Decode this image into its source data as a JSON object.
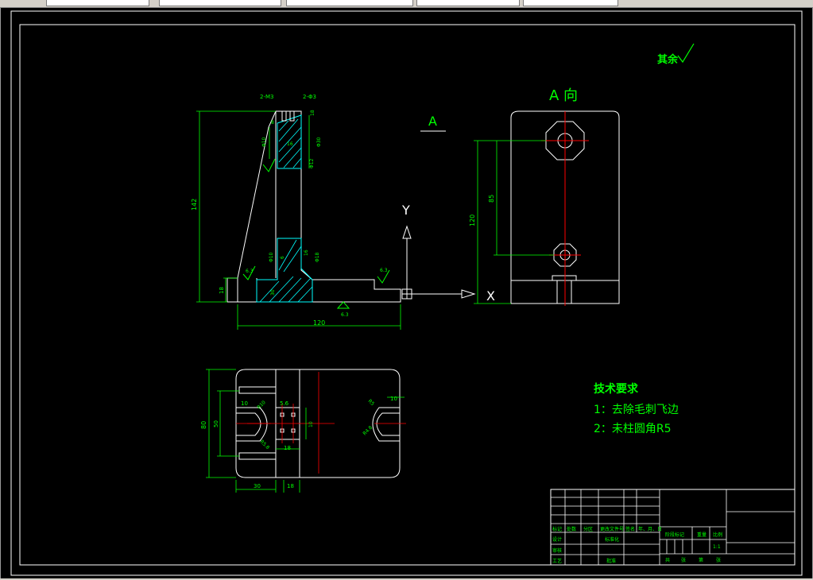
{
  "colors": {
    "background": "#000000",
    "outline": "#ffffff",
    "dimension": "#00ff00",
    "centerline": "#ff0000",
    "hatch": "#00ffff",
    "annotation": "#00ff00"
  },
  "tabs": [
    "",
    "",
    "",
    "",
    ""
  ],
  "roughness_note": "其余",
  "view_a_label": "A 向",
  "section_arrow_label": "A",
  "axis_y": "Y",
  "axis_x": "X",
  "front_view": {
    "dims": {
      "height_142": "142",
      "width_120": "120",
      "base_18": "18",
      "tap_left": "2-M3",
      "tap_right": "2-Φ3",
      "dia_10": "Φ10",
      "dia_30": "Φ30",
      "dim_16": "16",
      "dim_18_top": "18",
      "dim_8": "8",
      "dim_12": "Φ12",
      "dim_16_mid": "16",
      "dim_18_mid": "Φ18",
      "dim_6_mid": "6",
      "dim_10_mid": "Φ10",
      "dim_30_low": "30",
      "rough_1": "6.3",
      "rough_2": "6.3",
      "rough_3": "6.3"
    }
  },
  "side_view": {
    "dims": {
      "height_120": "120",
      "dim_85": "85"
    }
  },
  "top_view": {
    "dims": {
      "height_80": "80",
      "dim_50": "50",
      "dim_10_left": "10",
      "dim_10_right": "10",
      "dim_5_6": "5.6",
      "dim_10_mid": "10",
      "dim_18": "18",
      "dim_30": "30",
      "dim_18_bottom": "18",
      "r_left_1": "R10",
      "r_left_2": "R5.8",
      "r_right_1": "R5",
      "r_right_2": "R4.8"
    }
  },
  "tech_requirements": {
    "title": "技术要求",
    "items": [
      "1：去除毛刺飞边",
      "2：未柱圆角R5"
    ]
  },
  "title_block": {
    "row_labels": [
      "标记",
      "处数",
      "分区",
      "更改文件号",
      "签名",
      "年、月、日"
    ],
    "design": "设计",
    "standardization": "标准化",
    "review": "审核",
    "process": "工艺",
    "approve": "批准",
    "stage_mark": "阶段标记",
    "weight": "重量",
    "scale": "比例",
    "scale_value": "1:1",
    "sheet_total": "共",
    "sheet_label": "张",
    "sheet_no": "第",
    "sheet_no_label": "张"
  }
}
